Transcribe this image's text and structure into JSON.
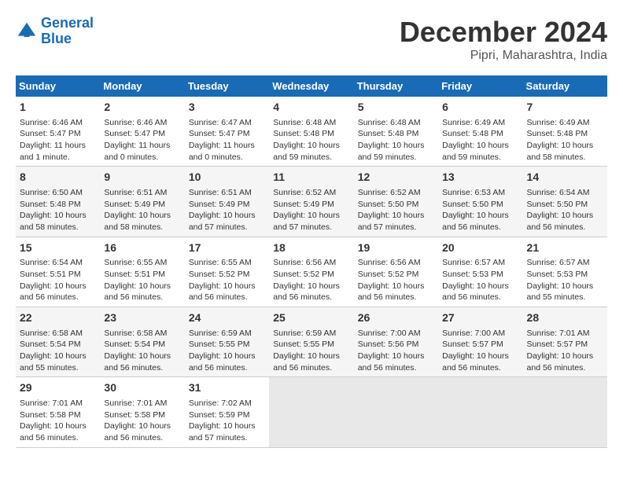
{
  "header": {
    "logo_line1": "General",
    "logo_line2": "Blue",
    "month": "December 2024",
    "location": "Pipri, Maharashtra, India"
  },
  "weekdays": [
    "Sunday",
    "Monday",
    "Tuesday",
    "Wednesday",
    "Thursday",
    "Friday",
    "Saturday"
  ],
  "weeks": [
    [
      {
        "day": 1,
        "info": "Sunrise: 6:46 AM\nSunset: 5:47 PM\nDaylight: 11 hours\nand 1 minute."
      },
      {
        "day": 2,
        "info": "Sunrise: 6:46 AM\nSunset: 5:47 PM\nDaylight: 11 hours\nand 0 minutes."
      },
      {
        "day": 3,
        "info": "Sunrise: 6:47 AM\nSunset: 5:47 PM\nDaylight: 11 hours\nand 0 minutes."
      },
      {
        "day": 4,
        "info": "Sunrise: 6:48 AM\nSunset: 5:48 PM\nDaylight: 10 hours\nand 59 minutes."
      },
      {
        "day": 5,
        "info": "Sunrise: 6:48 AM\nSunset: 5:48 PM\nDaylight: 10 hours\nand 59 minutes."
      },
      {
        "day": 6,
        "info": "Sunrise: 6:49 AM\nSunset: 5:48 PM\nDaylight: 10 hours\nand 59 minutes."
      },
      {
        "day": 7,
        "info": "Sunrise: 6:49 AM\nSunset: 5:48 PM\nDaylight: 10 hours\nand 58 minutes."
      }
    ],
    [
      {
        "day": 8,
        "info": "Sunrise: 6:50 AM\nSunset: 5:48 PM\nDaylight: 10 hours\nand 58 minutes."
      },
      {
        "day": 9,
        "info": "Sunrise: 6:51 AM\nSunset: 5:49 PM\nDaylight: 10 hours\nand 58 minutes."
      },
      {
        "day": 10,
        "info": "Sunrise: 6:51 AM\nSunset: 5:49 PM\nDaylight: 10 hours\nand 57 minutes."
      },
      {
        "day": 11,
        "info": "Sunrise: 6:52 AM\nSunset: 5:49 PM\nDaylight: 10 hours\nand 57 minutes."
      },
      {
        "day": 12,
        "info": "Sunrise: 6:52 AM\nSunset: 5:50 PM\nDaylight: 10 hours\nand 57 minutes."
      },
      {
        "day": 13,
        "info": "Sunrise: 6:53 AM\nSunset: 5:50 PM\nDaylight: 10 hours\nand 56 minutes."
      },
      {
        "day": 14,
        "info": "Sunrise: 6:54 AM\nSunset: 5:50 PM\nDaylight: 10 hours\nand 56 minutes."
      }
    ],
    [
      {
        "day": 15,
        "info": "Sunrise: 6:54 AM\nSunset: 5:51 PM\nDaylight: 10 hours\nand 56 minutes."
      },
      {
        "day": 16,
        "info": "Sunrise: 6:55 AM\nSunset: 5:51 PM\nDaylight: 10 hours\nand 56 minutes."
      },
      {
        "day": 17,
        "info": "Sunrise: 6:55 AM\nSunset: 5:52 PM\nDaylight: 10 hours\nand 56 minutes."
      },
      {
        "day": 18,
        "info": "Sunrise: 6:56 AM\nSunset: 5:52 PM\nDaylight: 10 hours\nand 56 minutes."
      },
      {
        "day": 19,
        "info": "Sunrise: 6:56 AM\nSunset: 5:52 PM\nDaylight: 10 hours\nand 56 minutes."
      },
      {
        "day": 20,
        "info": "Sunrise: 6:57 AM\nSunset: 5:53 PM\nDaylight: 10 hours\nand 56 minutes."
      },
      {
        "day": 21,
        "info": "Sunrise: 6:57 AM\nSunset: 5:53 PM\nDaylight: 10 hours\nand 55 minutes."
      }
    ],
    [
      {
        "day": 22,
        "info": "Sunrise: 6:58 AM\nSunset: 5:54 PM\nDaylight: 10 hours\nand 55 minutes."
      },
      {
        "day": 23,
        "info": "Sunrise: 6:58 AM\nSunset: 5:54 PM\nDaylight: 10 hours\nand 56 minutes."
      },
      {
        "day": 24,
        "info": "Sunrise: 6:59 AM\nSunset: 5:55 PM\nDaylight: 10 hours\nand 56 minutes."
      },
      {
        "day": 25,
        "info": "Sunrise: 6:59 AM\nSunset: 5:55 PM\nDaylight: 10 hours\nand 56 minutes."
      },
      {
        "day": 26,
        "info": "Sunrise: 7:00 AM\nSunset: 5:56 PM\nDaylight: 10 hours\nand 56 minutes."
      },
      {
        "day": 27,
        "info": "Sunrise: 7:00 AM\nSunset: 5:57 PM\nDaylight: 10 hours\nand 56 minutes."
      },
      {
        "day": 28,
        "info": "Sunrise: 7:01 AM\nSunset: 5:57 PM\nDaylight: 10 hours\nand 56 minutes."
      }
    ],
    [
      {
        "day": 29,
        "info": "Sunrise: 7:01 AM\nSunset: 5:58 PM\nDaylight: 10 hours\nand 56 minutes."
      },
      {
        "day": 30,
        "info": "Sunrise: 7:01 AM\nSunset: 5:58 PM\nDaylight: 10 hours\nand 56 minutes."
      },
      {
        "day": 31,
        "info": "Sunrise: 7:02 AM\nSunset: 5:59 PM\nDaylight: 10 hours\nand 57 minutes."
      },
      null,
      null,
      null,
      null
    ]
  ]
}
